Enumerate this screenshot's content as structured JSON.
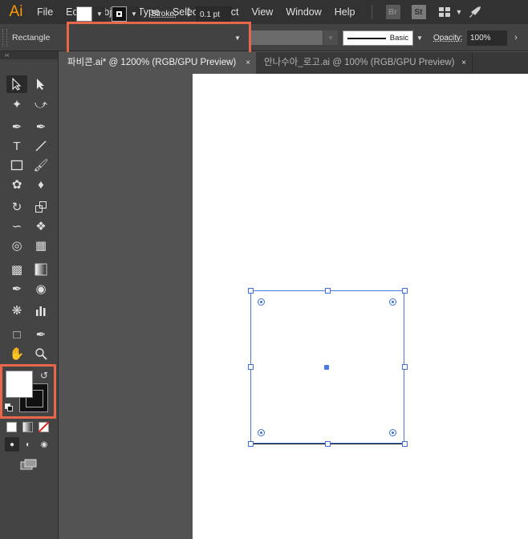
{
  "app": {
    "logo": "Ai"
  },
  "menu": {
    "items": [
      "File",
      "Edit",
      "Object",
      "Type",
      "Select",
      "Effect",
      "View",
      "Window",
      "Help"
    ]
  },
  "menubar_icons": {
    "bridge": "Br",
    "stock": "St",
    "workspace": "grid-icon",
    "publish": "rocket-icon"
  },
  "control_bar": {
    "selection_type": "Rectangle",
    "fill_color": "#ffffff",
    "stroke_color": "#000000",
    "stroke_label": "Stroke:",
    "stroke_weight": "0.1 pt",
    "brush_label": "Basic",
    "opacity_label": "Opacity:",
    "opacity_value": "100%"
  },
  "tabs": [
    {
      "label": "파비콘.ai* @ 1200% (RGB/GPU Preview)",
      "close": "×",
      "active": true
    },
    {
      "label": "안나수아_로고.ai @ 100% (RGB/GPU Preview)",
      "close": "×",
      "active": false
    }
  ],
  "toolbar": {
    "collapse": "‹‹",
    "fill_color": "#ffffff",
    "stroke_color": "#000000",
    "tools": [
      "selection-tool",
      "direct-selection-tool",
      "magic-wand-tool",
      "lasso-tool",
      "pen-tool",
      "curvature-tool",
      "type-tool",
      "line-segment-tool",
      "rectangle-tool",
      "paintbrush-tool",
      "shaper-tool",
      "eraser-tool",
      "rotate-tool",
      "scale-tool",
      "width-tool",
      "puppet-warp-tool",
      "shape-builder-tool",
      "perspective-grid-tool",
      "mesh-tool",
      "gradient-tool",
      "eyedropper-tool",
      "blend-tool",
      "symbol-sprayer-tool",
      "column-graph-tool",
      "artboard-tool",
      "slice-tool",
      "hand-tool",
      "zoom-tool"
    ]
  },
  "canvas": {
    "artboard_color": "#ffffff",
    "pasteboard_color": "#535353",
    "selection_color": "#3e6fd6"
  },
  "highlight_color": "#e8664a"
}
